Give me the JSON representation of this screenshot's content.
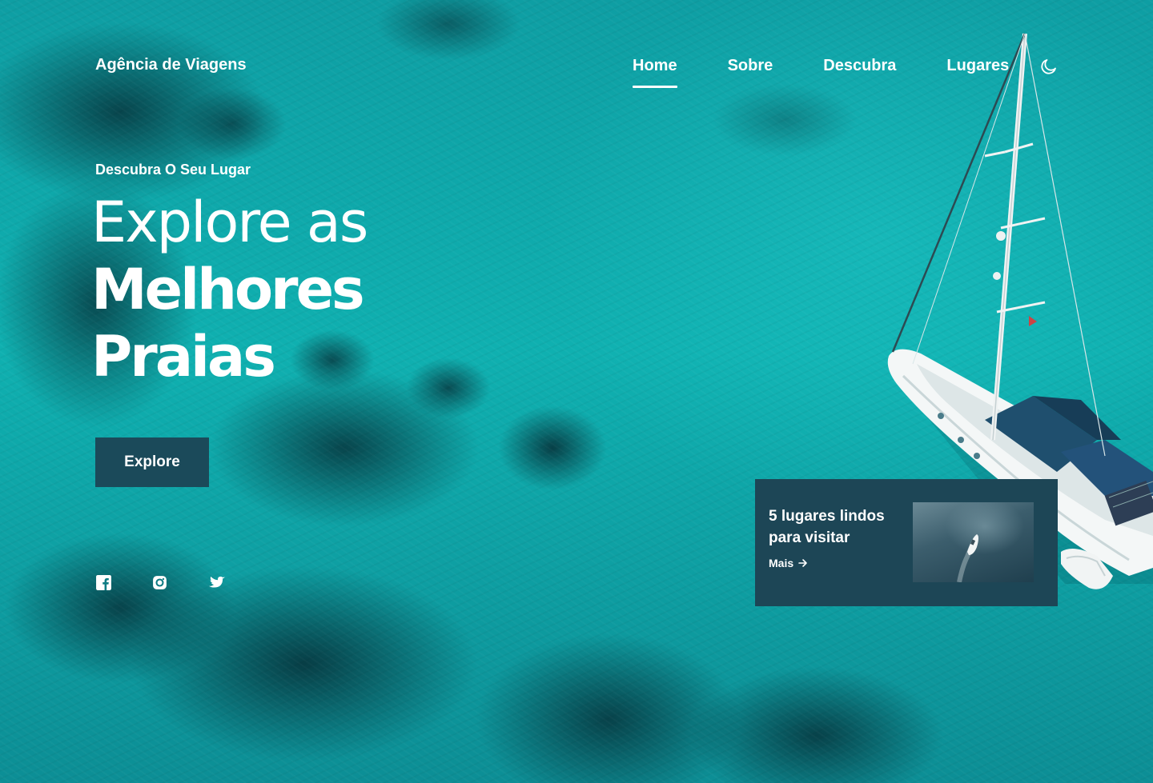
{
  "brand": {
    "logo_text": "Agência de Viagens"
  },
  "nav": {
    "items": [
      {
        "label": "Home",
        "active": true
      },
      {
        "label": "Sobre",
        "active": false
      },
      {
        "label": "Descubra",
        "active": false
      },
      {
        "label": "Lugares",
        "active": false
      }
    ],
    "theme_toggle_icon": "moon-icon"
  },
  "hero": {
    "subtitle": "Descubra O Seu Lugar",
    "title_line1": "Explore as",
    "title_line2": "Melhores",
    "title_line3": "Praias",
    "cta_label": "Explore"
  },
  "social": {
    "icons": [
      "facebook-icon",
      "instagram-icon",
      "twitter-icon"
    ]
  },
  "card": {
    "title": "5 lugares lindos para visitar",
    "more_label": "Mais",
    "more_icon": "arrow-right-icon"
  },
  "colors": {
    "accent_dark": "#1b4a5a",
    "card_bg": "#1d4656",
    "text": "#ffffff",
    "ocean": "#0fb0b0"
  }
}
